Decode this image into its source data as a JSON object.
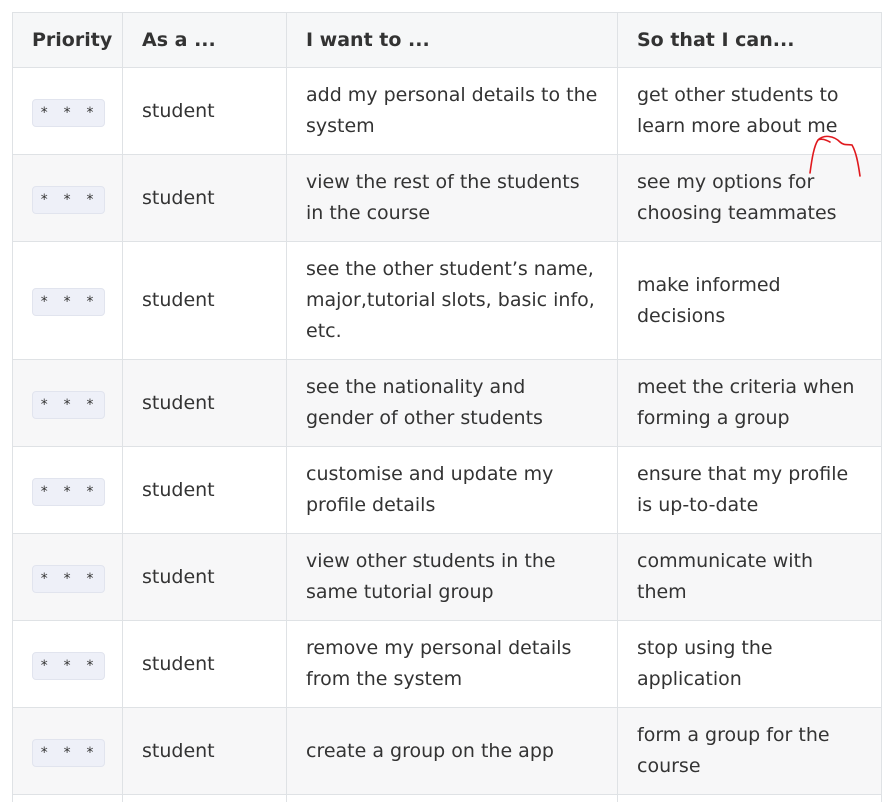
{
  "table": {
    "headers": [
      "Priority",
      "As a ...",
      "I want to ...",
      "So that I can..."
    ],
    "rows": [
      {
        "priority": "* * *",
        "as_a": "student",
        "want": "add my personal details to the system",
        "so_that": "get other students to learn more about me"
      },
      {
        "priority": "* * *",
        "as_a": "student",
        "want": "view the rest of the students in the course",
        "so_that": "see my options for choosing teammates"
      },
      {
        "priority": "* * *",
        "as_a": "student",
        "want": "see the other student’s name, major,tutorial slots, basic info, etc.",
        "so_that": "make informed decisions"
      },
      {
        "priority": "* * *",
        "as_a": "student",
        "want": "see the nationality and gender of other students",
        "so_that": "meet the criteria when forming a group"
      },
      {
        "priority": "* * *",
        "as_a": "student",
        "want": "customise and update my profile details",
        "so_that": "ensure that my profile is up-to-date"
      },
      {
        "priority": "* * *",
        "as_a": "student",
        "want": "view other students in the same tutorial group",
        "so_that": "communicate with them"
      },
      {
        "priority": "* * *",
        "as_a": "student",
        "want": "remove my personal details from the system",
        "so_that": "stop using the application"
      },
      {
        "priority": "* * *",
        "as_a": "student",
        "want": "create a group on the app",
        "so_that": "form a group for the course"
      }
    ]
  },
  "annotation": {
    "color": "#e0191e"
  }
}
